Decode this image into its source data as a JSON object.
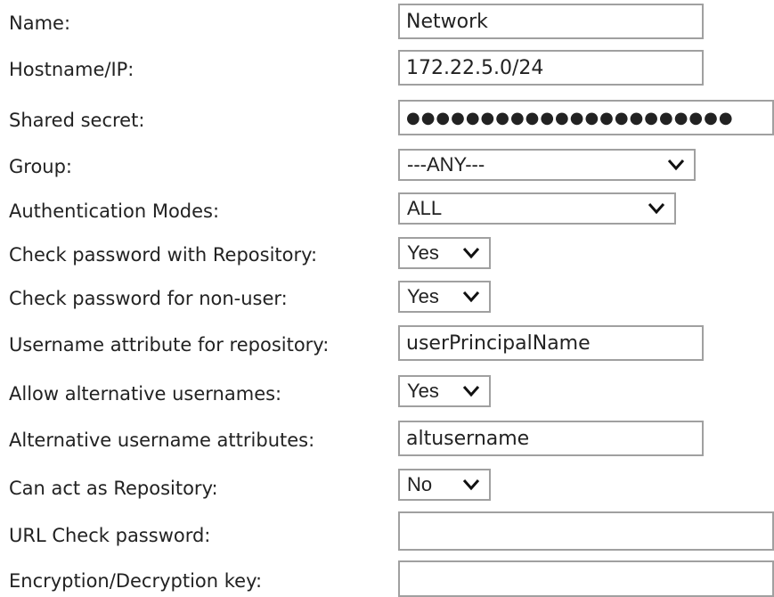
{
  "form": {
    "name": {
      "label": "Name:",
      "value": "Network"
    },
    "hostname": {
      "label": "Hostname/IP:",
      "value": "172.22.5.0/24"
    },
    "shared_secret": {
      "label": "Shared secret:",
      "value": "●●●●●●●●●●●●●●●●●●●●●●"
    },
    "group": {
      "label": "Group:",
      "value": "---ANY---"
    },
    "auth_modes": {
      "label": "Authentication Modes:",
      "value": "ALL"
    },
    "check_pw_repo": {
      "label": "Check password with Repository:",
      "value": "Yes"
    },
    "check_pw_nonuser": {
      "label": "Check password for non-user:",
      "value": "Yes"
    },
    "username_attr": {
      "label": "Username attribute for repository:",
      "value": "userPrincipalName"
    },
    "allow_alt": {
      "label": "Allow alternative usernames:",
      "value": "Yes"
    },
    "alt_attrs": {
      "label": "Alternative username attributes:",
      "value": "altusername"
    },
    "can_act_repo": {
      "label": "Can act as Repository:",
      "value": "No"
    },
    "url_check": {
      "label": "URL Check password:",
      "value": ""
    },
    "enc_key": {
      "label": "Encryption/Decryption key:",
      "value": ""
    }
  }
}
